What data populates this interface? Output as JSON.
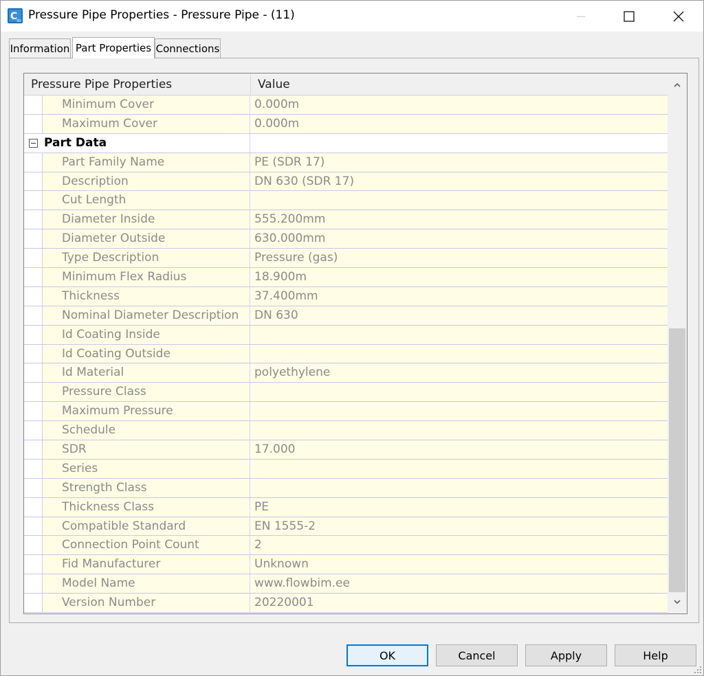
{
  "window": {
    "title": "Pressure Pipe Properties - Pressure Pipe - (11)",
    "app_icon_letter": "C",
    "app_icon_sub": "3D"
  },
  "tabs": [
    {
      "label": "Information",
      "active": false
    },
    {
      "label": "Part Properties",
      "active": true
    },
    {
      "label": "Connections",
      "active": false
    }
  ],
  "grid": {
    "columns": [
      "Pressure Pipe Properties",
      "Value"
    ],
    "rows": [
      {
        "type": "property",
        "name": "Minimum Cover",
        "value": "0.000m"
      },
      {
        "type": "property",
        "name": "Maximum Cover",
        "value": "0.000m"
      },
      {
        "type": "category",
        "name": "Part Data",
        "value": "",
        "expanded": true
      },
      {
        "type": "property",
        "name": "Part Family Name",
        "value": "PE (SDR 17)"
      },
      {
        "type": "property",
        "name": "Description",
        "value": "DN 630 (SDR 17)"
      },
      {
        "type": "property",
        "name": "Cut Length",
        "value": ""
      },
      {
        "type": "property",
        "name": "Diameter Inside",
        "value": "555.200mm"
      },
      {
        "type": "property",
        "name": "Diameter Outside",
        "value": "630.000mm"
      },
      {
        "type": "property",
        "name": "Type Description",
        "value": "Pressure (gas)"
      },
      {
        "type": "property",
        "name": "Minimum Flex Radius",
        "value": "18.900m"
      },
      {
        "type": "property",
        "name": "Thickness",
        "value": "37.400mm"
      },
      {
        "type": "property",
        "name": "Nominal Diameter Description",
        "value": "DN 630"
      },
      {
        "type": "property",
        "name": "Id Coating Inside",
        "value": ""
      },
      {
        "type": "property",
        "name": "Id Coating Outside",
        "value": ""
      },
      {
        "type": "property",
        "name": "Id Material",
        "value": "polyethylene"
      },
      {
        "type": "property",
        "name": "Pressure Class",
        "value": ""
      },
      {
        "type": "property",
        "name": "Maximum Pressure",
        "value": ""
      },
      {
        "type": "property",
        "name": "Schedule",
        "value": ""
      },
      {
        "type": "property",
        "name": "SDR",
        "value": "17.000"
      },
      {
        "type": "property",
        "name": "Series",
        "value": ""
      },
      {
        "type": "property",
        "name": "Strength Class",
        "value": ""
      },
      {
        "type": "property",
        "name": "Thickness Class",
        "value": "PE"
      },
      {
        "type": "property",
        "name": "Compatible Standard",
        "value": "EN 1555-2"
      },
      {
        "type": "property",
        "name": "Connection Point Count",
        "value": "2"
      },
      {
        "type": "property",
        "name": "Fid Manufacturer",
        "value": "Unknown"
      },
      {
        "type": "property",
        "name": "Model Name",
        "value": "www.flowbim.ee"
      },
      {
        "type": "property",
        "name": "Version Number",
        "value": "20220001"
      }
    ]
  },
  "buttons": {
    "ok": "OK",
    "cancel": "Cancel",
    "apply": "Apply",
    "help": "Help"
  },
  "colors": {
    "accent": "#0078d7",
    "property_bg": "#fffde6",
    "readonly_text": "#8b8b8b"
  }
}
